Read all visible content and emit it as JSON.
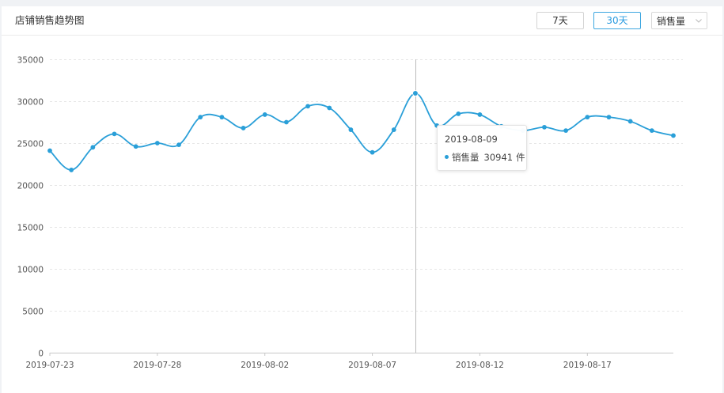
{
  "header": {
    "title": "店铺销售趋势图",
    "buttons": [
      {
        "label": "7天",
        "active": false
      },
      {
        "label": "30天",
        "active": true
      }
    ],
    "select": {
      "value": "销售量"
    }
  },
  "tooltip": {
    "date": "2019-08-09",
    "series_name": "销售量",
    "value": "30941",
    "unit": "件"
  },
  "colors": {
    "line": "#2a9fd8",
    "grid": "#e6e6e6",
    "axis": "#c8c8c8",
    "crosshair": "#bbbbbb",
    "text": "#555555"
  },
  "chart_data": {
    "type": "line",
    "title": "",
    "xlabel": "",
    "ylabel": "",
    "ylim": [
      0,
      35000
    ],
    "yticks": [
      0,
      5000,
      10000,
      15000,
      20000,
      25000,
      30000,
      35000
    ],
    "xtick_labels": [
      "2019-07-23",
      "2019-07-28",
      "2019-08-02",
      "2019-08-07",
      "2019-08-12",
      "2019-08-17"
    ],
    "grid": true,
    "legend": "none",
    "x": [
      "2019-07-23",
      "2019-07-24",
      "2019-07-25",
      "2019-07-26",
      "2019-07-27",
      "2019-07-28",
      "2019-07-29",
      "2019-07-30",
      "2019-07-31",
      "2019-08-01",
      "2019-08-02",
      "2019-08-03",
      "2019-08-04",
      "2019-08-05",
      "2019-08-06",
      "2019-08-07",
      "2019-08-08",
      "2019-08-09",
      "2019-08-10",
      "2019-08-11",
      "2019-08-12",
      "2019-08-13",
      "2019-08-14",
      "2019-08-15",
      "2019-08-16",
      "2019-08-17",
      "2019-08-18",
      "2019-08-19",
      "2019-08-20",
      "2019-08-21"
    ],
    "series": [
      {
        "values": [
          24100,
          21800,
          24500,
          26100,
          24600,
          25000,
          24800,
          28100,
          28100,
          26800,
          28400,
          27500,
          29400,
          29200,
          26600,
          23900,
          26600,
          30941,
          27100,
          28500,
          28400,
          27000,
          26500,
          26900,
          26500,
          28100,
          28100,
          27600,
          26500,
          25900
        ]
      }
    ],
    "highlight_index": 17
  }
}
